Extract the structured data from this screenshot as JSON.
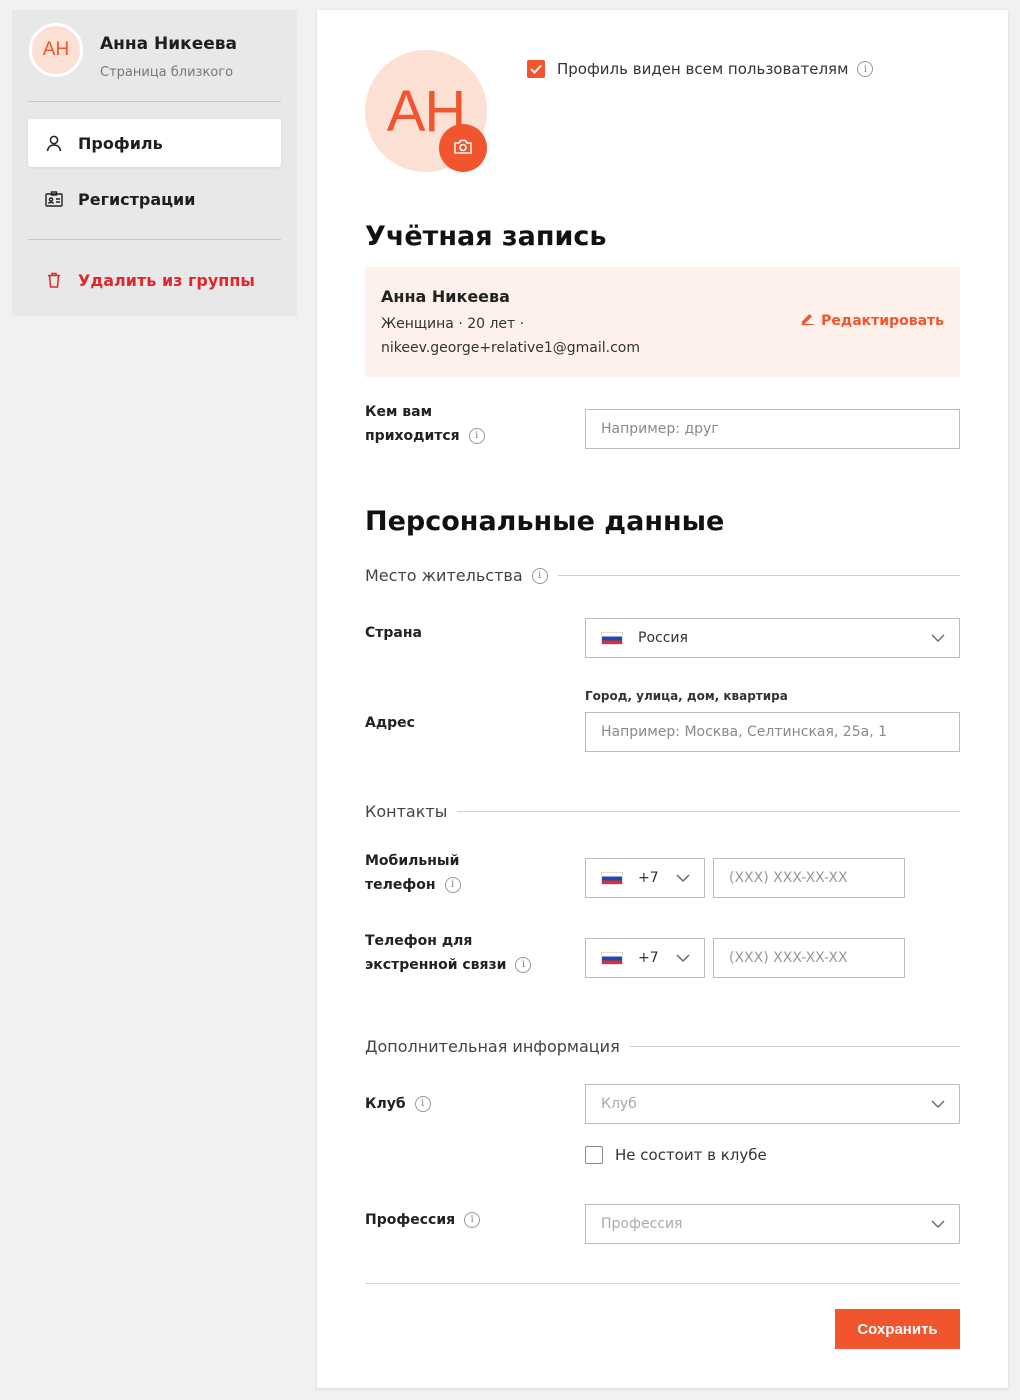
{
  "sidebar": {
    "user": {
      "initials": "АН",
      "name": "Анна Никеева",
      "subtitle": "Страница близкого"
    },
    "items": [
      {
        "label": "Профиль",
        "icon": "user-icon",
        "active": true
      },
      {
        "label": "Регистрации",
        "icon": "id-card-icon",
        "active": false
      }
    ],
    "delete_label": "Удалить из группы"
  },
  "profile": {
    "initials": "АН",
    "visibility_label": "Профиль виден всем пользователям",
    "visibility_checked": true
  },
  "account": {
    "heading": "Учётная запись",
    "name": "Анна Никеева",
    "details_line1": "Женщина · 20 лет ·",
    "details_line2": "nikeev.george+relative1@gmail.com",
    "edit_label": "Редактировать",
    "relation_label_1": "Кем вам",
    "relation_label_2": "приходится",
    "relation_placeholder": "Например: друг"
  },
  "personal": {
    "heading": "Персональные данные",
    "residence_title": "Место жительства",
    "country_label": "Страна",
    "country_value": "Россия",
    "address_label": "Адрес",
    "address_hint": "Город, улица, дом, квартира",
    "address_placeholder": "Например: Москва, Селтинская, 25а, 1",
    "contacts_title": "Контакты",
    "mobile_label_1": "Мобильный",
    "mobile_label_2": "телефон",
    "mobile_code": "+7",
    "mobile_placeholder": "(XXX) XXX-XX-XX",
    "emergency_label_1": "Телефон для",
    "emergency_label_2": "экстренной связи",
    "emergency_code": "+7",
    "emergency_placeholder": "(XXX) XXX-XX-XX",
    "additional_title": "Дополнительная информация",
    "club_label": "Клуб",
    "club_placeholder": "Клуб",
    "no_club_label": "Не состоит в клубе",
    "profession_label": "Профессия",
    "profession_placeholder": "Профессия"
  },
  "save_label": "Сохранить",
  "colors": {
    "accent": "#f0552e",
    "danger": "#e0282a",
    "card_bg": "#fef1ec"
  }
}
